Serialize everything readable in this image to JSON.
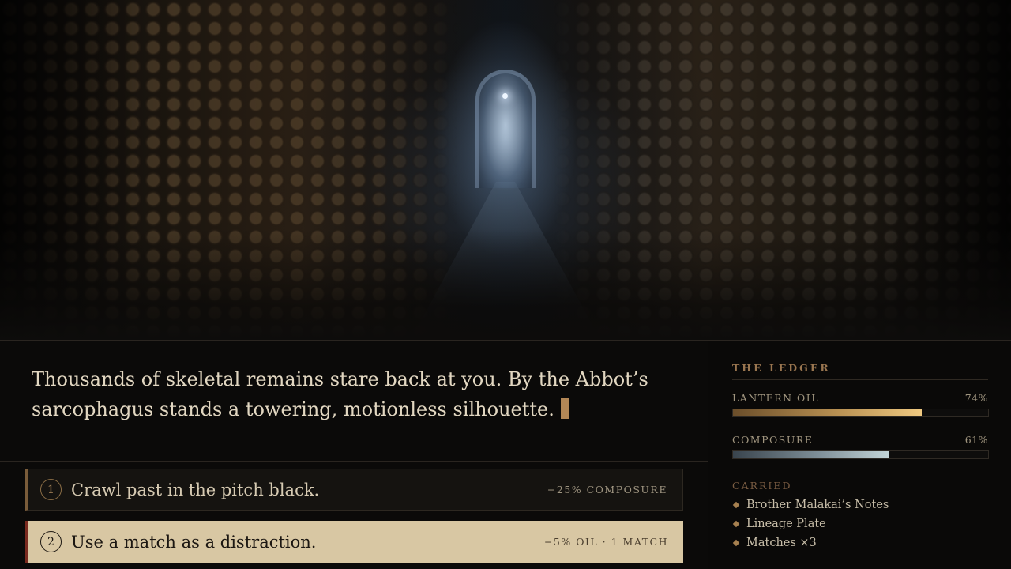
{
  "narration": {
    "text": "Thousands of skeletal remains stare back at you. By the Abbot’s sarcophagus stands a towering, motionless silhouette."
  },
  "choices": [
    {
      "number": "1",
      "text": "Crawl past in the pitch black.",
      "cost": "−25% COMPOSURE"
    },
    {
      "number": "2",
      "text": "Use a match as a distraction.",
      "cost": "−5% OIL · 1 MATCH"
    }
  ],
  "ledger": {
    "title": "THE LEDGER",
    "stats": [
      {
        "label": "LANTERN OIL",
        "value": "74%",
        "level": 0.74,
        "color": "#efc981"
      },
      {
        "label": "COMPOSURE",
        "value": "61%",
        "level": 0.61,
        "color": "#c3d4d6"
      }
    ],
    "carried_title": "CARRIED",
    "carried": [
      "Brother Malakai’s Notes",
      "Lineage Plate",
      "Matches ×3"
    ]
  },
  "colors": {
    "accent": "#b38756",
    "selected_choice_bg": "#d8c7a3",
    "selected_choice_edge": "#7a2a1f"
  },
  "icons": {
    "carried_bullet": "diamond-icon",
    "caret": "text-caret"
  }
}
